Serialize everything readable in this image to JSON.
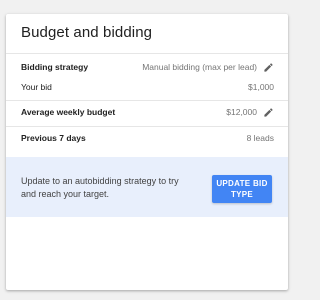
{
  "card": {
    "title": "Budget and bidding",
    "bidding_strategy": {
      "label": "Bidding strategy",
      "value": "Manual bidding (max per lead)"
    },
    "your_bid": {
      "label": "Your bid",
      "value": "$1,000"
    },
    "average_weekly_budget": {
      "label": "Average weekly budget",
      "value": "$12,000"
    },
    "previous_7_days": {
      "label": "Previous 7 days",
      "value": "8 leads"
    }
  },
  "banner": {
    "text": "Update to an autobidding strategy to try and reach your target.",
    "button_label": "UPDATE BID TYPE"
  },
  "colors": {
    "accent": "#4285f4",
    "banner_background": "#e8effc",
    "page_background": "#f1f1f1"
  },
  "icons": {
    "edit": "pencil-icon"
  }
}
